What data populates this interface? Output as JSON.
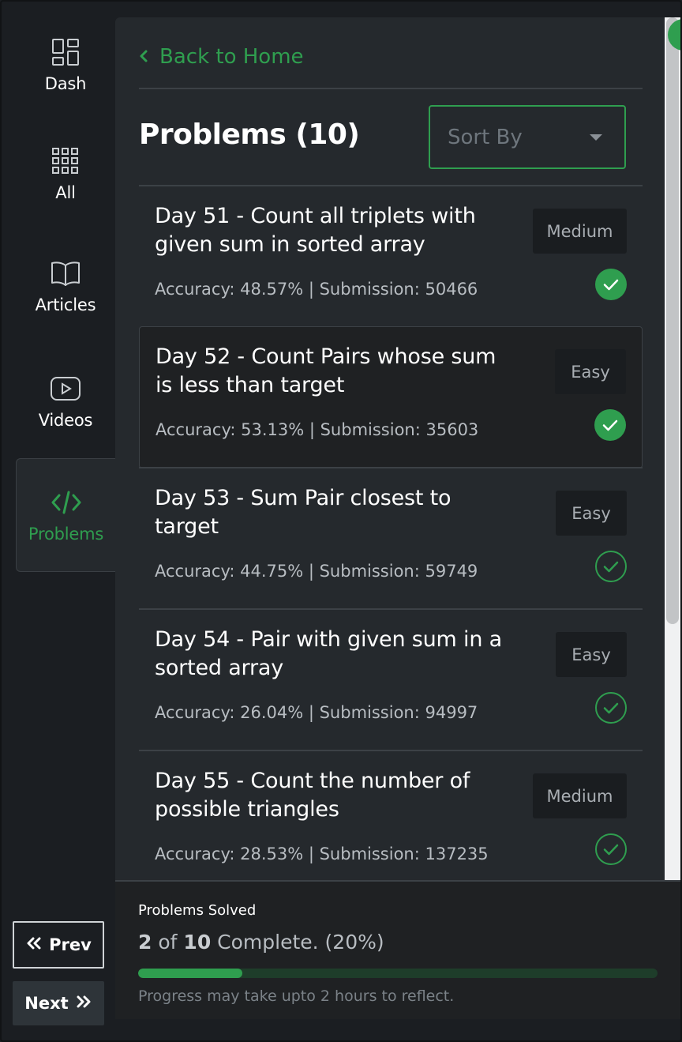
{
  "nav": {
    "items": [
      {
        "label": "Dash",
        "icon": "dashboard-icon"
      },
      {
        "label": "All",
        "icon": "grid-icon"
      },
      {
        "label": "Articles",
        "icon": "book-icon"
      },
      {
        "label": "Videos",
        "icon": "video-icon"
      },
      {
        "label": "Problems",
        "icon": "code-icon"
      }
    ],
    "active": "Problems",
    "prev_label": "Prev",
    "next_label": "Next"
  },
  "header": {
    "back_label": "Back to Home",
    "title": "Problems (10)",
    "sort_placeholder": "Sort By"
  },
  "problems": [
    {
      "title": "Day 51 - Count all triplets with given sum in sorted array",
      "difficulty": "Medium",
      "stats": "Accuracy: 48.57% | Submission: 50466",
      "solved": true
    },
    {
      "title": "Day 52 - Count Pairs whose sum is less than target",
      "difficulty": "Easy",
      "stats": "Accuracy: 53.13% | Submission: 35603",
      "solved": true
    },
    {
      "title": "Day 53 - Sum Pair closest to target",
      "difficulty": "Easy",
      "stats": "Accuracy: 44.75% | Submission: 59749",
      "solved": false
    },
    {
      "title": "Day 54 - Pair with given sum in a sorted array",
      "difficulty": "Easy",
      "stats": "Accuracy: 26.04% | Submission: 94997",
      "solved": false
    },
    {
      "title": "Day 55 - Count the number of possible triangles",
      "difficulty": "Medium",
      "stats": "Accuracy: 28.53% | Submission: 137235",
      "solved": false
    }
  ],
  "progress": {
    "title": "Problems Solved",
    "solved": "2",
    "of_text": "of",
    "total": "10",
    "complete_text": "Complete. (20%)",
    "fraction": 0.2,
    "note": "Progress may take upto 2 hours to reflect."
  },
  "colors": {
    "accent": "#2f9e4f",
    "background": "#1b1e22",
    "panel": "#25292d"
  }
}
